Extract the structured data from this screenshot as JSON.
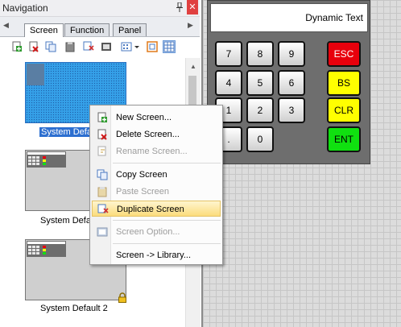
{
  "navigation": {
    "title": "Navigation",
    "pin_glyph": "📌",
    "close_glyph": "✕",
    "tabs": [
      {
        "label": "Screen",
        "active": true
      },
      {
        "label": "Function",
        "active": false
      },
      {
        "label": "Panel",
        "active": false
      }
    ],
    "tab_scroll_left": "◀",
    "tab_scroll_right": "▶",
    "toolbar_icons": [
      "new-screen-icon",
      "delete-screen-icon",
      "copy-screen-icon",
      "paste-screen-icon",
      "duplicate-screen-icon",
      "screen-option-icon",
      "view-icon",
      "dropdown-arrow-icon",
      "single-view-icon",
      "grid-view-icon"
    ],
    "thumbnails": [
      {
        "label": "System Defau",
        "selected": true,
        "locked": false
      },
      {
        "label": "System Defa",
        "selected": false,
        "locked": false
      },
      {
        "label": "System Default 2",
        "selected": false,
        "locked": true
      }
    ],
    "scroll_up_glyph": "▲"
  },
  "canvas": {
    "display_text": "Dynamic Text",
    "keys": [
      {
        "label": "7",
        "style": "normal"
      },
      {
        "label": "8",
        "style": "normal"
      },
      {
        "label": "9",
        "style": "normal"
      },
      {
        "label": "ESC",
        "style": "red"
      },
      {
        "label": "4",
        "style": "normal"
      },
      {
        "label": "5",
        "style": "normal"
      },
      {
        "label": "6",
        "style": "normal"
      },
      {
        "label": "BS",
        "style": "yellow"
      },
      {
        "label": "1",
        "style": "normal"
      },
      {
        "label": "2",
        "style": "normal"
      },
      {
        "label": "3",
        "style": "normal"
      },
      {
        "label": "CLR",
        "style": "yellow"
      },
      {
        "label": ".",
        "style": "normal"
      },
      {
        "label": "0",
        "style": "normal"
      },
      {
        "label": "",
        "style": "hidden"
      },
      {
        "label": "ENT",
        "style": "green"
      }
    ],
    "colors": {
      "esc": "#e8000c",
      "bs": "#ffff00",
      "clr": "#ffff00",
      "ent": "#10e010"
    }
  },
  "context_menu": {
    "items": [
      {
        "label": "New Screen...",
        "icon": "new-screen-icon",
        "enabled": true
      },
      {
        "label": "Delete Screen...",
        "icon": "delete-screen-icon",
        "enabled": true
      },
      {
        "label": "Rename Screen...",
        "icon": "rename-screen-icon",
        "enabled": false
      },
      {
        "label": "Copy Screen",
        "icon": "copy-screen-icon",
        "enabled": true
      },
      {
        "label": "Paste Screen",
        "icon": "paste-screen-icon",
        "enabled": false
      },
      {
        "label": "Duplicate Screen",
        "icon": "duplicate-screen-icon",
        "enabled": true,
        "highlighted": true
      },
      {
        "label": "Screen Option...",
        "icon": "screen-option-icon",
        "enabled": false
      },
      {
        "label": "Screen -> Library...",
        "icon": "",
        "enabled": true
      }
    ]
  }
}
